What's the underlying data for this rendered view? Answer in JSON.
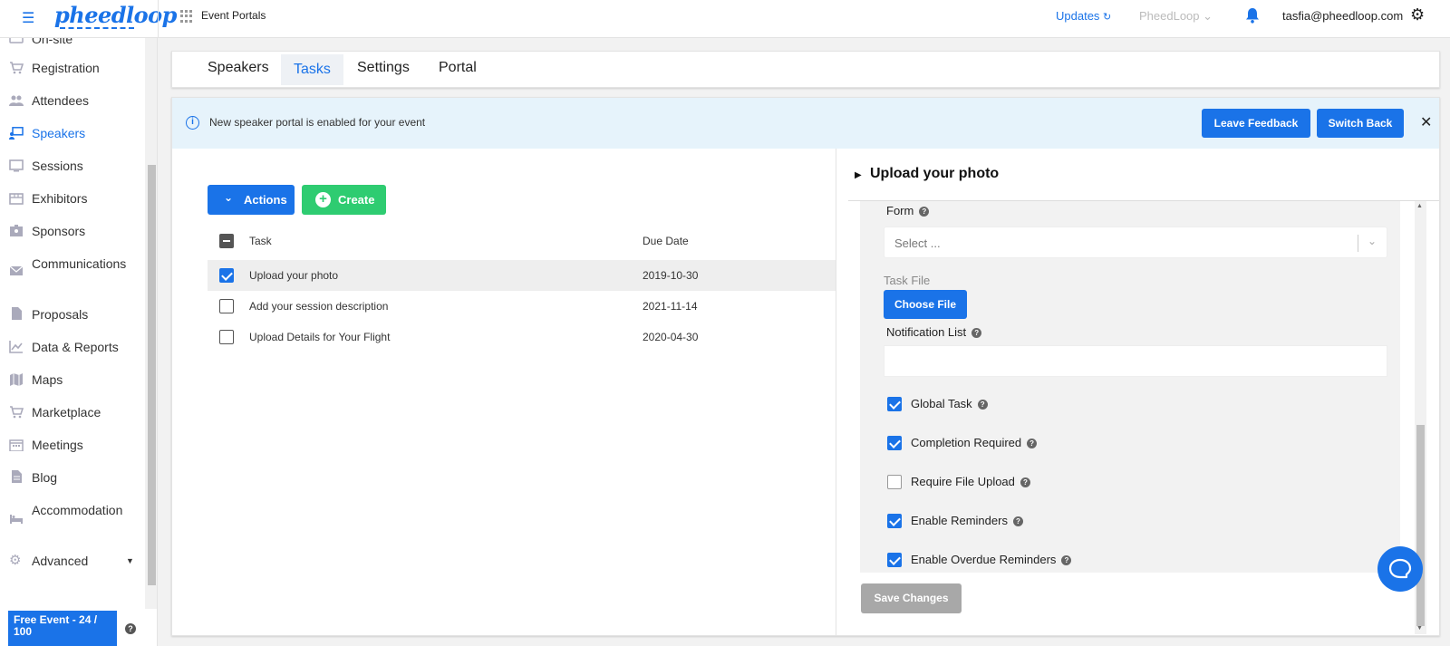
{
  "topbar": {
    "logo": "pheedloop",
    "event_portals": "Event Portals",
    "updates": "Updates",
    "org_select": "PheedLoop",
    "user_email": "tasfia@pheedloop.com"
  },
  "sidebar": {
    "items": [
      {
        "label": "On-site",
        "icon": "onsite-icon"
      },
      {
        "label": "Registration",
        "icon": "cart-icon"
      },
      {
        "label": "Attendees",
        "icon": "people-icon"
      },
      {
        "label": "Speakers",
        "icon": "presenter-icon",
        "active": true
      },
      {
        "label": "Sessions",
        "icon": "screen-icon"
      },
      {
        "label": "Exhibitors",
        "icon": "store-icon"
      },
      {
        "label": "Sponsors",
        "icon": "badge-icon"
      },
      {
        "label": "Communications",
        "icon": "mail-icon"
      },
      {
        "label": "Proposals",
        "icon": "document-icon"
      },
      {
        "label": "Data & Reports",
        "icon": "chart-icon"
      },
      {
        "label": "Maps",
        "icon": "map-icon"
      },
      {
        "label": "Marketplace",
        "icon": "cart-icon"
      },
      {
        "label": "Meetings",
        "icon": "calendar-icon"
      },
      {
        "label": "Blog",
        "icon": "blog-icon"
      },
      {
        "label": "Accommodation",
        "icon": "bed-icon"
      },
      {
        "label": "Advanced",
        "icon": "gear-icon"
      }
    ],
    "plan_badge": "Free Event - 24 / 100"
  },
  "tabs": [
    "Speakers",
    "Tasks",
    "Settings",
    "Portal"
  ],
  "active_tab": "Tasks",
  "banner": {
    "text": "New speaker portal is enabled for your event",
    "leave_feedback": "Leave Feedback",
    "switch_back": "Switch Back"
  },
  "tasks": {
    "actions_label": "Actions",
    "create_label": "Create",
    "col_task": "Task",
    "col_due": "Due Date",
    "rows": [
      {
        "name": "Upload your photo",
        "due": "2019-10-30",
        "checked": true
      },
      {
        "name": "Add your session description",
        "due": "2021-11-14",
        "checked": false
      },
      {
        "name": "Upload Details for Your Flight",
        "due": "2020-04-30",
        "checked": false
      }
    ]
  },
  "detail": {
    "title": "Upload your photo",
    "form_label": "Form",
    "form_placeholder": "Select ...",
    "task_file_label": "Task File",
    "choose_file": "Choose File",
    "notification_label": "Notification List",
    "options": [
      {
        "label": "Global Task",
        "checked": true
      },
      {
        "label": "Completion Required",
        "checked": true
      },
      {
        "label": "Require File Upload",
        "checked": false
      },
      {
        "label": "Enable Reminders",
        "checked": true
      },
      {
        "label": "Enable Overdue Reminders",
        "checked": true
      }
    ],
    "save_label": "Save Changes"
  },
  "colors": {
    "accent": "#1a73e8",
    "create": "#2ecc71",
    "banner_bg": "#e6f3fb"
  }
}
